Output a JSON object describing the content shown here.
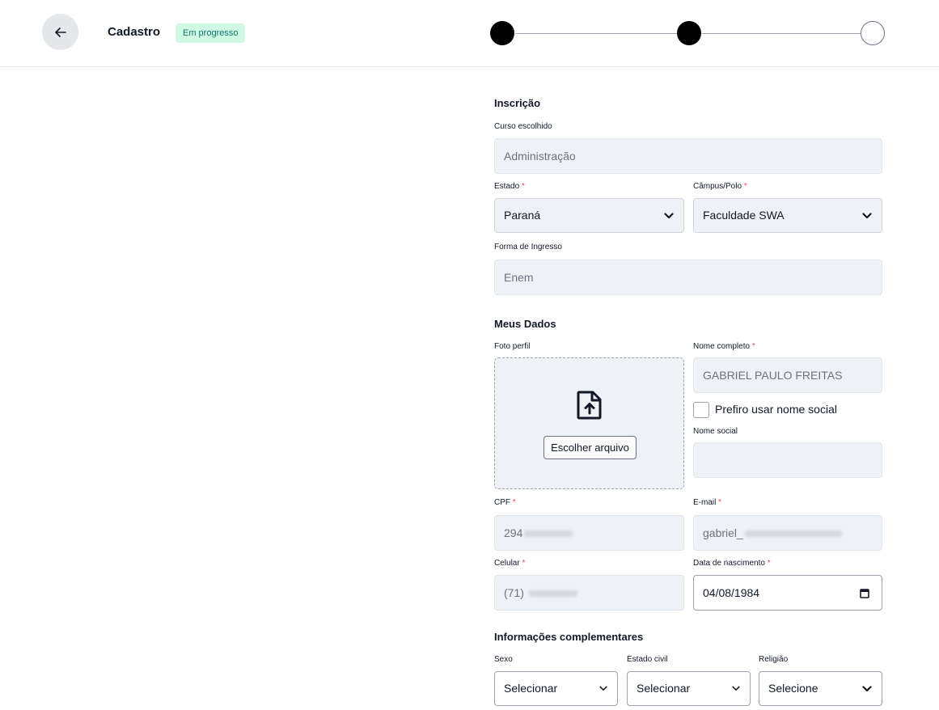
{
  "header": {
    "title": "Cadastro",
    "status": "Em progresso",
    "steps": [
      "done",
      "done",
      "todo"
    ]
  },
  "inscricao": {
    "section_title": "Inscrição",
    "curso": {
      "label": "Curso escolhido",
      "value": "Administração"
    },
    "estado": {
      "label": "Estado",
      "required": "*",
      "value": "Paraná"
    },
    "campus": {
      "label": "Câmpus/Polo",
      "required": "*",
      "value": "Faculdade SWA"
    },
    "forma": {
      "label": "Forma de Ingresso",
      "value": "Enem"
    }
  },
  "meus_dados": {
    "section_title": "Meus Dados",
    "foto": {
      "label": "Foto perfil",
      "button": "Escolher arquivo"
    },
    "nome": {
      "label": "Nome completo",
      "required": "*",
      "value": "GABRIEL PAULO FREITAS"
    },
    "nome_social_checkbox": "Prefiro usar nome social",
    "nome_social": {
      "label": "Nome social",
      "value": ""
    },
    "cpf": {
      "label": "CPF",
      "required": "*",
      "value_prefix": "294"
    },
    "email": {
      "label": "E-mail",
      "required": "*",
      "value_prefix": "gabriel_"
    },
    "celular": {
      "label": "Celular",
      "required": "*",
      "value_prefix": "(71)"
    },
    "nascimento": {
      "label": "Data de nascimento",
      "required": "*",
      "value": "04/08/1984"
    }
  },
  "complementares": {
    "section_title": "Informações complementares",
    "sexo": {
      "label": "Sexo",
      "value": "Selecionar"
    },
    "estado_civil": {
      "label": "Estado civil",
      "value": "Selecionar"
    },
    "religiao": {
      "label": "Religião",
      "value": "Selecione"
    }
  }
}
